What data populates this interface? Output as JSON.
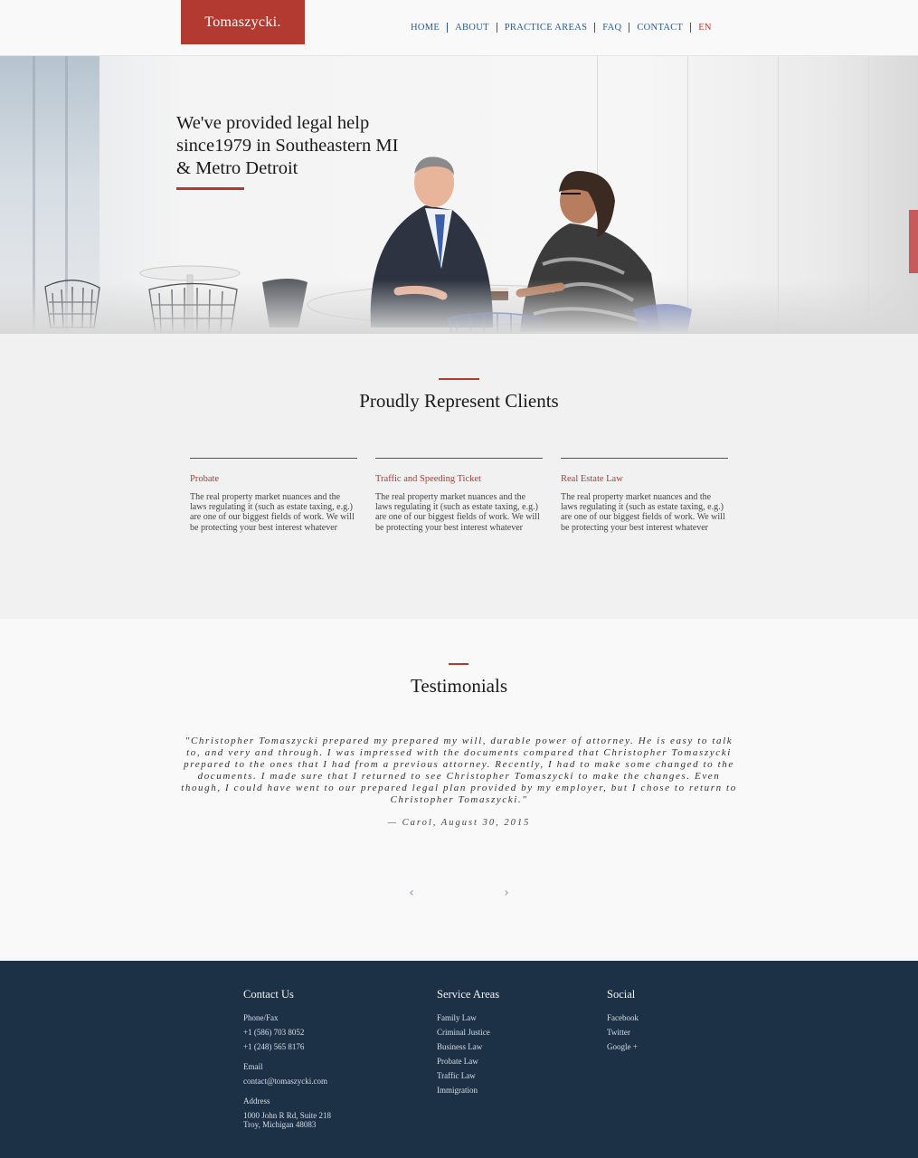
{
  "header": {
    "logo": "Tomaszycki.",
    "nav": [
      {
        "label": "HOME"
      },
      {
        "label": "ABOUT"
      },
      {
        "label": "PRACTICE AREAS"
      },
      {
        "label": "FAQ"
      },
      {
        "label": "CONTACT"
      },
      {
        "label": "EN"
      }
    ]
  },
  "hero": {
    "headline": "We've provided legal help since1979 in Southeastern MI & Metro Detroit",
    "accent_color": "#b23a30"
  },
  "clients": {
    "title": "Proudly Represent Clients",
    "cards": [
      {
        "title": "Probate",
        "text": "The real property market nuances and the laws regulating it (such as estate taxing, e.g.) are one of our biggest fields of work. We will be protecting your best interest whatever the..."
      },
      {
        "title": "Traffic and Speeding Ticket",
        "text": "The real property market nuances and the laws regulating it (such as estate taxing, e.g.) are one of our biggest fields of work. We will be protecting your best interest whatever the..."
      },
      {
        "title": "Real Estate Law",
        "text": "The real property market nuances and the laws regulating it (such as estate taxing, e.g.) are one of our biggest fields of work. We will be protecting your best interest whatever the..."
      }
    ]
  },
  "testimonials": {
    "title": "Testimonials",
    "quote": "\"Christopher Tomaszycki prepared my prepared my will, durable power of attorney. He is easy to talk to, and very and through. I was impressed with the documents compared that Christopher Tomaszycki prepared to the ones that I had from a previous attorney. Recently, I had to make some changed to the documents. I made sure that I returned to see Christopher Tomaszycki to make the changes. Even though, I could have went to our prepared legal plan provided by my employer, but I chose to return to Christopher Tomaszycki.\"",
    "author": "— Carol, August 30, 2015",
    "prev_icon": "chevron-left-icon",
    "next_icon": "chevron-right-icon"
  },
  "footer": {
    "background": "#1c3146",
    "contact": {
      "title": "Contact Us",
      "phone_label": "Phone/Fax",
      "phone1": "+1 (586) 703 8052",
      "phone2": "+1 (248) 565 8176",
      "email_label": "Email",
      "email": "contact@tomaszycki.com",
      "address_label": "Address",
      "address_line1": "1000 John R Rd, Suite 218",
      "address_line2": "Troy, Michigan 48083"
    },
    "service": {
      "title": "Service Areas",
      "items": [
        "Family Law",
        "Criminal Justice",
        "Business Law",
        "Probate Law",
        "Traffic Law",
        "Immigration"
      ]
    },
    "social": {
      "title": "Social",
      "items": [
        "Facebook",
        "Twitter",
        "Google +"
      ]
    }
  }
}
